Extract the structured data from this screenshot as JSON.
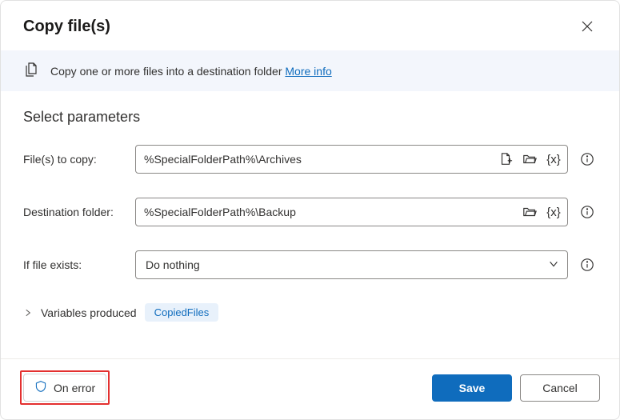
{
  "dialog": {
    "title": "Copy file(s)",
    "description": "Copy one or more files into a destination folder",
    "more_info_label": "More info"
  },
  "section_title": "Select parameters",
  "fields": {
    "files_to_copy": {
      "label": "File(s) to copy:",
      "value": "%SpecialFolderPath%\\Archives"
    },
    "destination_folder": {
      "label": "Destination folder:",
      "value": "%SpecialFolderPath%\\Backup"
    },
    "if_file_exists": {
      "label": "If file exists:",
      "value": "Do nothing"
    }
  },
  "variables": {
    "label": "Variables produced",
    "badge": "CopiedFiles"
  },
  "footer": {
    "on_error": "On error",
    "save": "Save",
    "cancel": "Cancel"
  }
}
